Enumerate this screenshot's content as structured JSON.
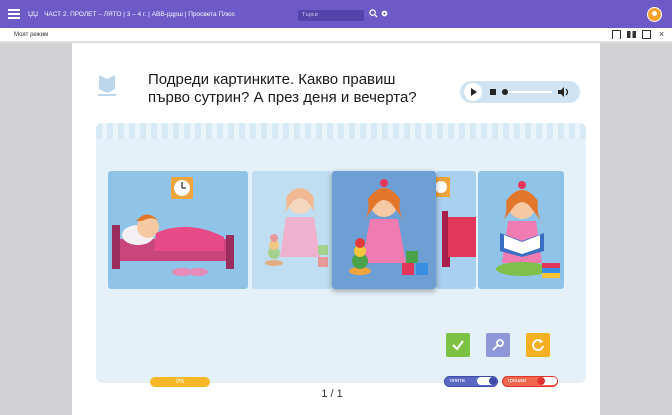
{
  "topbar": {
    "logo": "ЏЏ",
    "title": "ЧАСТ 2. ПРОЛЕТ – ЛЯТО | 3 – 4 г. | АВВ-рдрш | Просвета Плюс",
    "search_placeholder": "Търси",
    "colors": {
      "bar": "#6d5ac7",
      "avatar": "#f7a22b"
    }
  },
  "subbar": {
    "mode_label": "Моят режим"
  },
  "exercise": {
    "question": "Подреди картинките. Какво правиш първо сутрин? А през деня и вечерта?",
    "cards": [
      {
        "scene": "girl-sleeping-in-bed",
        "clock": true
      },
      {
        "scene": "girl-playing-with-toys-faded",
        "clock": false
      },
      {
        "scene": "girl-playing-with-toys",
        "clock": false
      },
      {
        "scene": "bed-with-clock",
        "clock": true
      },
      {
        "scene": "girl-reading-book",
        "clock": false
      }
    ],
    "actions": {
      "check_color": "#7cc143",
      "key_color": "#8e97d8",
      "reset_color": "#f6b021"
    }
  },
  "footer": {
    "score": "0%",
    "page_counter": "1 / 1",
    "tries_label": "опити",
    "errors_label": "грешки"
  }
}
